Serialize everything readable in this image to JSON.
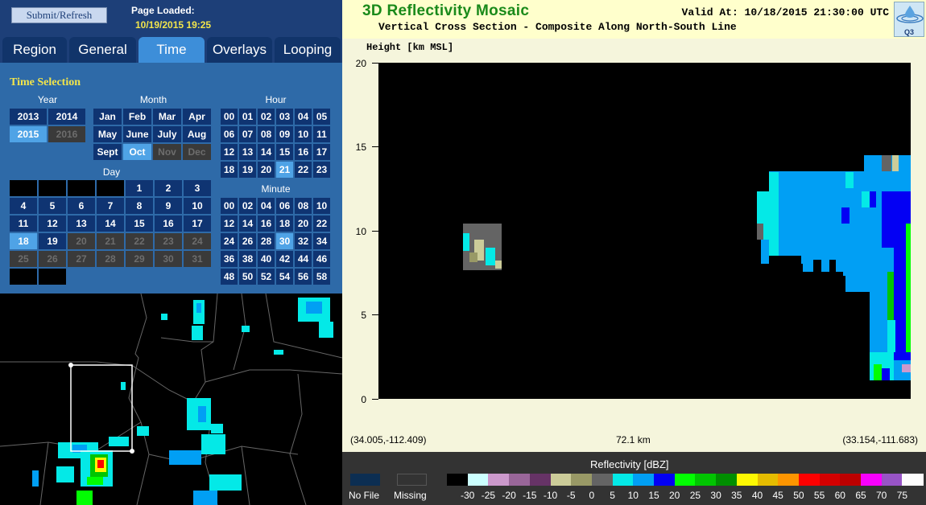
{
  "left": {
    "submit_label": "Submit/Refresh",
    "page_loaded_label": "Page Loaded:",
    "page_loaded_value": "10/19/2015 19:25",
    "tabs": [
      "Region",
      "General",
      "Time",
      "Overlays",
      "Looping"
    ],
    "active_tab": "Time",
    "time_selection_title": "Time Selection",
    "year_header": "Year",
    "month_header": "Month",
    "hour_header": "Hour",
    "day_header": "Day",
    "minute_header": "Minute",
    "years": [
      {
        "v": "2013",
        "s": "n"
      },
      {
        "v": "2014",
        "s": "n"
      },
      {
        "v": "2015",
        "s": "sel"
      },
      {
        "v": "2016",
        "s": "dis"
      }
    ],
    "months": [
      {
        "v": "Jan",
        "s": "n"
      },
      {
        "v": "Feb",
        "s": "n"
      },
      {
        "v": "Mar",
        "s": "n"
      },
      {
        "v": "Apr",
        "s": "n"
      },
      {
        "v": "May",
        "s": "n"
      },
      {
        "v": "June",
        "s": "n"
      },
      {
        "v": "July",
        "s": "n"
      },
      {
        "v": "Aug",
        "s": "n"
      },
      {
        "v": "Sept",
        "s": "n"
      },
      {
        "v": "Oct",
        "s": "sel"
      },
      {
        "v": "Nov",
        "s": "dis"
      },
      {
        "v": "Dec",
        "s": "dis"
      }
    ],
    "hours": [
      {
        "v": "00",
        "s": "n"
      },
      {
        "v": "01",
        "s": "n"
      },
      {
        "v": "02",
        "s": "n"
      },
      {
        "v": "03",
        "s": "n"
      },
      {
        "v": "04",
        "s": "n"
      },
      {
        "v": "05",
        "s": "n"
      },
      {
        "v": "06",
        "s": "n"
      },
      {
        "v": "07",
        "s": "n"
      },
      {
        "v": "08",
        "s": "n"
      },
      {
        "v": "09",
        "s": "n"
      },
      {
        "v": "10",
        "s": "n"
      },
      {
        "v": "11",
        "s": "n"
      },
      {
        "v": "12",
        "s": "n"
      },
      {
        "v": "13",
        "s": "n"
      },
      {
        "v": "14",
        "s": "n"
      },
      {
        "v": "15",
        "s": "n"
      },
      {
        "v": "16",
        "s": "n"
      },
      {
        "v": "17",
        "s": "n"
      },
      {
        "v": "18",
        "s": "n"
      },
      {
        "v": "19",
        "s": "n"
      },
      {
        "v": "20",
        "s": "n"
      },
      {
        "v": "21",
        "s": "sel"
      },
      {
        "v": "22",
        "s": "n"
      },
      {
        "v": "23",
        "s": "n"
      }
    ],
    "days": [
      {
        "v": "",
        "s": "blank"
      },
      {
        "v": "",
        "s": "blank"
      },
      {
        "v": "",
        "s": "blank"
      },
      {
        "v": "",
        "s": "blank"
      },
      {
        "v": "1",
        "s": "n"
      },
      {
        "v": "2",
        "s": "n"
      },
      {
        "v": "3",
        "s": "n"
      },
      {
        "v": "4",
        "s": "n"
      },
      {
        "v": "5",
        "s": "n"
      },
      {
        "v": "6",
        "s": "n"
      },
      {
        "v": "7",
        "s": "n"
      },
      {
        "v": "8",
        "s": "n"
      },
      {
        "v": "9",
        "s": "n"
      },
      {
        "v": "10",
        "s": "n"
      },
      {
        "v": "11",
        "s": "n"
      },
      {
        "v": "12",
        "s": "n"
      },
      {
        "v": "13",
        "s": "n"
      },
      {
        "v": "14",
        "s": "n"
      },
      {
        "v": "15",
        "s": "n"
      },
      {
        "v": "16",
        "s": "n"
      },
      {
        "v": "17",
        "s": "n"
      },
      {
        "v": "18",
        "s": "sel"
      },
      {
        "v": "19",
        "s": "n"
      },
      {
        "v": "20",
        "s": "dis"
      },
      {
        "v": "21",
        "s": "dis"
      },
      {
        "v": "22",
        "s": "dis"
      },
      {
        "v": "23",
        "s": "dis"
      },
      {
        "v": "24",
        "s": "dis"
      },
      {
        "v": "25",
        "s": "dis"
      },
      {
        "v": "26",
        "s": "dis"
      },
      {
        "v": "27",
        "s": "dis"
      },
      {
        "v": "28",
        "s": "dis"
      },
      {
        "v": "29",
        "s": "dis"
      },
      {
        "v": "30",
        "s": "dis"
      },
      {
        "v": "31",
        "s": "dis"
      },
      {
        "v": "",
        "s": "blank"
      },
      {
        "v": "",
        "s": "blank"
      }
    ],
    "minutes": [
      {
        "v": "00",
        "s": "n"
      },
      {
        "v": "02",
        "s": "n"
      },
      {
        "v": "04",
        "s": "n"
      },
      {
        "v": "06",
        "s": "n"
      },
      {
        "v": "08",
        "s": "n"
      },
      {
        "v": "10",
        "s": "n"
      },
      {
        "v": "12",
        "s": "n"
      },
      {
        "v": "14",
        "s": "n"
      },
      {
        "v": "16",
        "s": "n"
      },
      {
        "v": "18",
        "s": "n"
      },
      {
        "v": "20",
        "s": "n"
      },
      {
        "v": "22",
        "s": "n"
      },
      {
        "v": "24",
        "s": "n"
      },
      {
        "v": "26",
        "s": "n"
      },
      {
        "v": "28",
        "s": "n"
      },
      {
        "v": "30",
        "s": "sel"
      },
      {
        "v": "32",
        "s": "n"
      },
      {
        "v": "34",
        "s": "n"
      },
      {
        "v": "36",
        "s": "n"
      },
      {
        "v": "38",
        "s": "n"
      },
      {
        "v": "40",
        "s": "n"
      },
      {
        "v": "42",
        "s": "n"
      },
      {
        "v": "44",
        "s": "n"
      },
      {
        "v": "46",
        "s": "n"
      },
      {
        "v": "48",
        "s": "n"
      },
      {
        "v": "50",
        "s": "n"
      },
      {
        "v": "52",
        "s": "n"
      },
      {
        "v": "54",
        "s": "n"
      },
      {
        "v": "56",
        "s": "n"
      },
      {
        "v": "58",
        "s": "n"
      }
    ]
  },
  "right": {
    "title": "3D Reflectivity Mosaic",
    "subtitle": "Vertical Cross Section - Composite Along North-South Line",
    "valid": "Valid At: 10/18/2015 21:30:00 UTC",
    "logo_text": "Q3",
    "ylabel": "Height [km MSL]",
    "yticks": [
      "20",
      "15",
      "10",
      "5",
      "0"
    ],
    "left_coord": "(34.005,-112.409)",
    "distance": "72.1 km",
    "right_coord": "(33.154,-111.683)",
    "legend_title": "Reflectivity [dBZ]",
    "nofile_label": "No File",
    "missing_label": "Missing",
    "legend_colors": [
      "#000000",
      "#ccffff",
      "#cc99cc",
      "#996699",
      "#663366",
      "#cccc99",
      "#999966",
      "#646464",
      "#04e9e7",
      "#019ff4",
      "#0300f4",
      "#02fd02",
      "#01c501",
      "#008e00",
      "#fdf802",
      "#e5bc00",
      "#fd9500",
      "#fd0000",
      "#d40000",
      "#bc0000",
      "#f800fd",
      "#9854c6",
      "#fdfdfd"
    ],
    "legend_labels": [
      "-30",
      "-25",
      "-20",
      "-15",
      "-10",
      "-5",
      "0",
      "5",
      "10",
      "15",
      "20",
      "25",
      "30",
      "35",
      "40",
      "45",
      "50",
      "55",
      "60",
      "65",
      "70",
      "75"
    ]
  },
  "chart_data": {
    "type": "heatmap",
    "ylabel": "Height [km MSL]",
    "ylim": [
      0,
      20
    ],
    "yticks": [
      0,
      5,
      10,
      15,
      20
    ],
    "x_start_label": "(34.005,-112.409)",
    "x_end_label": "(33.154,-111.683)",
    "x_length_km": 72.1,
    "colorbar_label": "Reflectivity [dBZ]",
    "colorbar_ticks": [
      -30,
      -25,
      -20,
      -15,
      -10,
      -5,
      0,
      5,
      10,
      15,
      20,
      25,
      30,
      35,
      40,
      45,
      50,
      55,
      60,
      65,
      70,
      75
    ],
    "echo_regions": [
      {
        "x_km": [
          11.0,
          14.0
        ],
        "height_km": [
          8.0,
          10.5
        ],
        "dbz": [
          0,
          10
        ]
      },
      {
        "x_km": [
          61.0,
          72.1
        ],
        "height_km": [
          8.5,
          14.5
        ],
        "dbz": [
          10,
          20
        ]
      },
      {
        "x_km": [
          66.0,
          72.1
        ],
        "height_km": [
          1.2,
          8.5
        ],
        "dbz": [
          10,
          30
        ]
      }
    ]
  }
}
